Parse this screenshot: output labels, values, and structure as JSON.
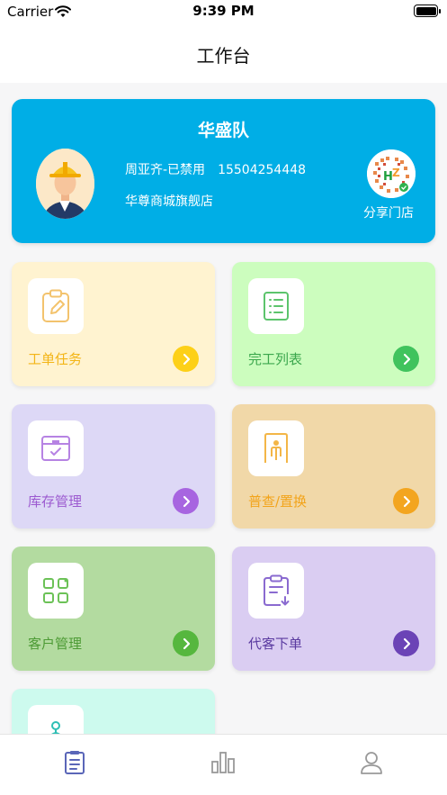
{
  "status_bar": {
    "carrier": "Carrier",
    "time": "9:39 PM"
  },
  "nav": {
    "title": "工作台"
  },
  "profile": {
    "team": "华盛队",
    "user": "周亚齐-已禁用",
    "phone": "15504254448",
    "store": "华尊商城旗舰店",
    "share_label": "分享门店"
  },
  "cards": [
    {
      "label": "工单任务",
      "icon": "clipboard-edit-icon",
      "color": "#f3b517"
    },
    {
      "label": "完工列表",
      "icon": "list-icon",
      "color": "#3ba74d"
    },
    {
      "label": "库存管理",
      "icon": "inventory-box-icon",
      "color": "#9c5ad0"
    },
    {
      "label": "普查/置换",
      "icon": "door-person-icon",
      "color": "#f2a41b"
    },
    {
      "label": "客户管理",
      "icon": "grid-icon",
      "color": "#4d9b35"
    },
    {
      "label": "代客下单",
      "icon": "clipboard-download-icon",
      "color": "#5a3aa0"
    },
    {
      "label": "",
      "icon": "branch-icon",
      "color": "#2ebfb5"
    }
  ],
  "tabbar": {
    "tabs": [
      {
        "icon": "clipboard-tab-icon",
        "active": true
      },
      {
        "icon": "bar-chart-tab-icon",
        "active": false
      },
      {
        "icon": "person-tab-icon",
        "active": false
      }
    ]
  },
  "colors": {
    "accent": "#00aee6",
    "tab_active": "#5a66b8",
    "tab_inactive": "#999999"
  }
}
